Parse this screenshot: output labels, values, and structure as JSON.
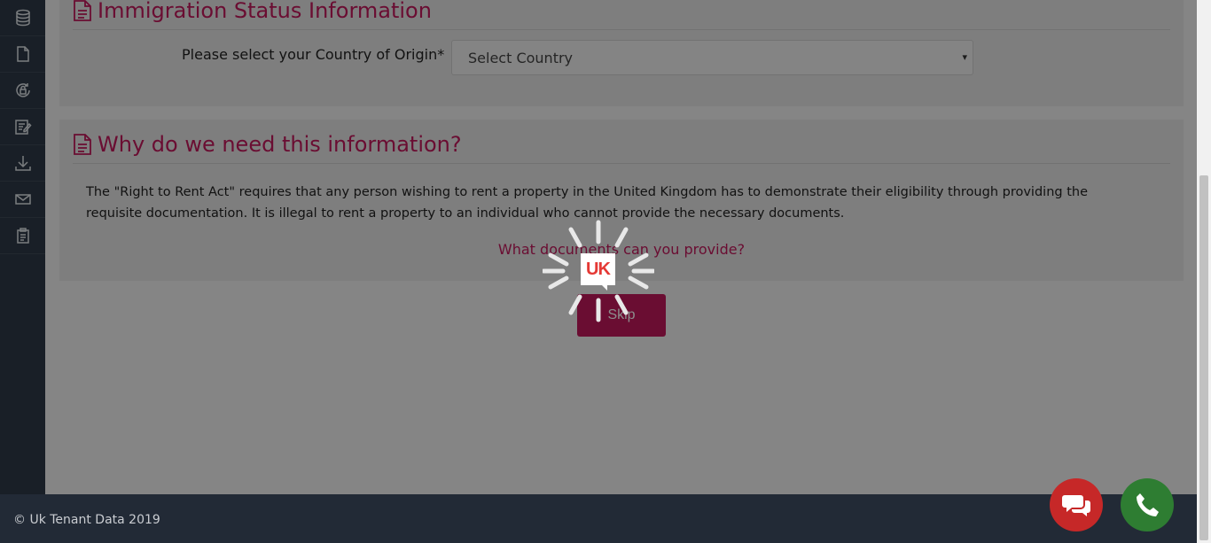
{
  "sidebar": {
    "items": [
      {
        "icon": "database-icon"
      },
      {
        "icon": "document-icon"
      },
      {
        "icon": "lock-cycle-icon"
      },
      {
        "icon": "edit-note-icon"
      },
      {
        "icon": "download-icon"
      },
      {
        "icon": "mail-icon"
      },
      {
        "icon": "clipboard-icon"
      }
    ]
  },
  "immigration": {
    "title": "Immigration Status Information",
    "country_label": "Please select your Country of Origin*",
    "country_select": "Select Country"
  },
  "info": {
    "title": "Why do we need this information?",
    "body": "The \"Right to Rent Act\" requires that any person wishing to rent a property in the United Kingdom has to demonstrate their eligibility through providing the requisite documentation. It is illegal to rent a property to an individual who cannot provide the necessary documents.",
    "link": "What documents can you provide?"
  },
  "skip_label": "Skip",
  "footer": {
    "copyright": "© Uk Tenant Data 2019"
  },
  "loader": {
    "logo_text": "UK"
  },
  "colors": {
    "accent": "#c2185b",
    "sidebar": "#2f3a48",
    "footer": "#222a36",
    "chat": "#c62828",
    "phone": "#2e7d32"
  }
}
